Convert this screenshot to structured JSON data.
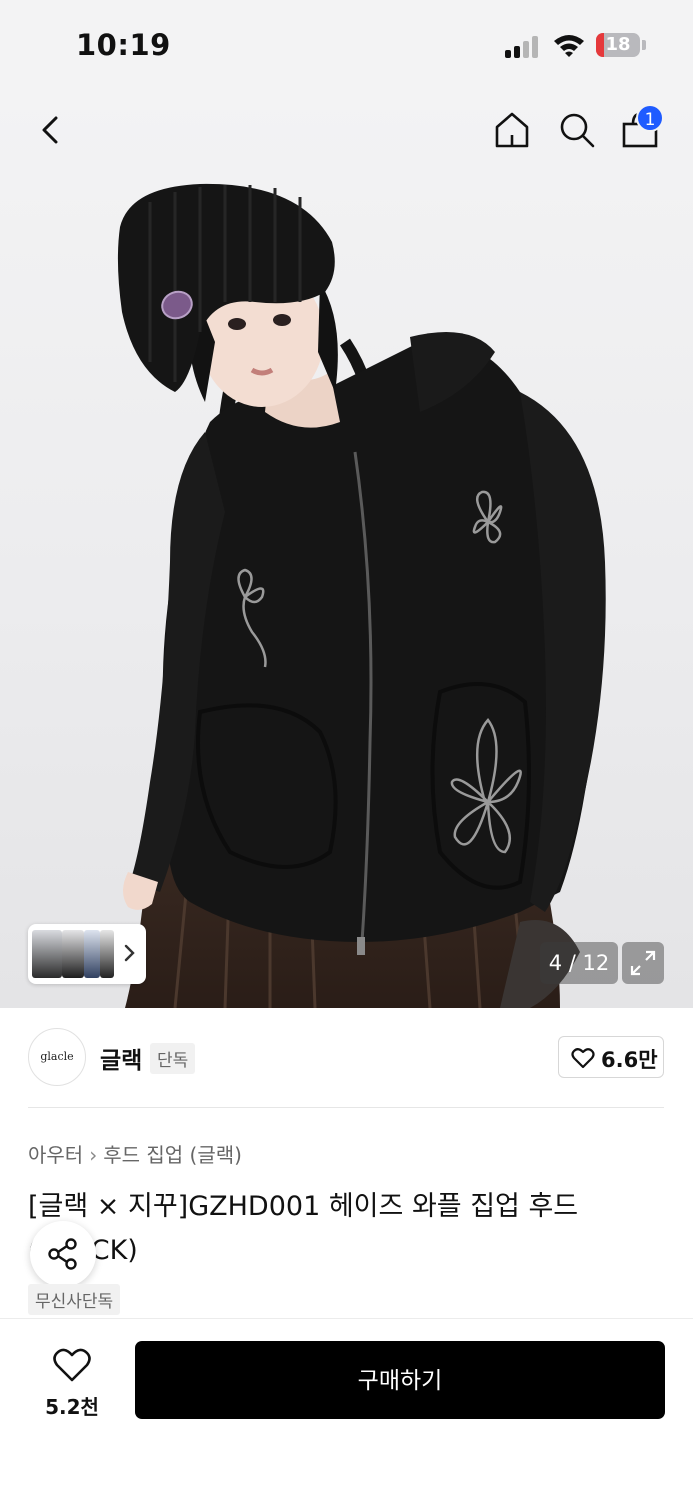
{
  "status_bar": {
    "time": "10:19",
    "battery_level": 18,
    "battery_color": "#e5383b"
  },
  "nav": {
    "back_icon": "chevron-left-icon",
    "home_icon": "home-icon",
    "search_icon": "search-icon",
    "cart_icon": "shopping-bag-icon",
    "cart_count": "1"
  },
  "gallery": {
    "counter": "4 / 12",
    "expand_icon": "expand-icon"
  },
  "brand": {
    "logo_text": "glacle",
    "name": "글랙",
    "tag": "단독",
    "likes": "6.6만"
  },
  "breadcrumb": {
    "category": "아우터",
    "subcategory": "후드 집업 (글랙)"
  },
  "product": {
    "title": "[글랙 × 지꾸]GZHD001 헤이즈 와플 집업 후드 (BLACK)",
    "exclusive_tag": "무신사단독"
  },
  "bottom_bar": {
    "wishlist_count": "5.2천",
    "buy_label": "구매하기"
  },
  "colors": {
    "accent": "#1f5bff",
    "buy_button": "#000000",
    "background": "#ffffff"
  }
}
